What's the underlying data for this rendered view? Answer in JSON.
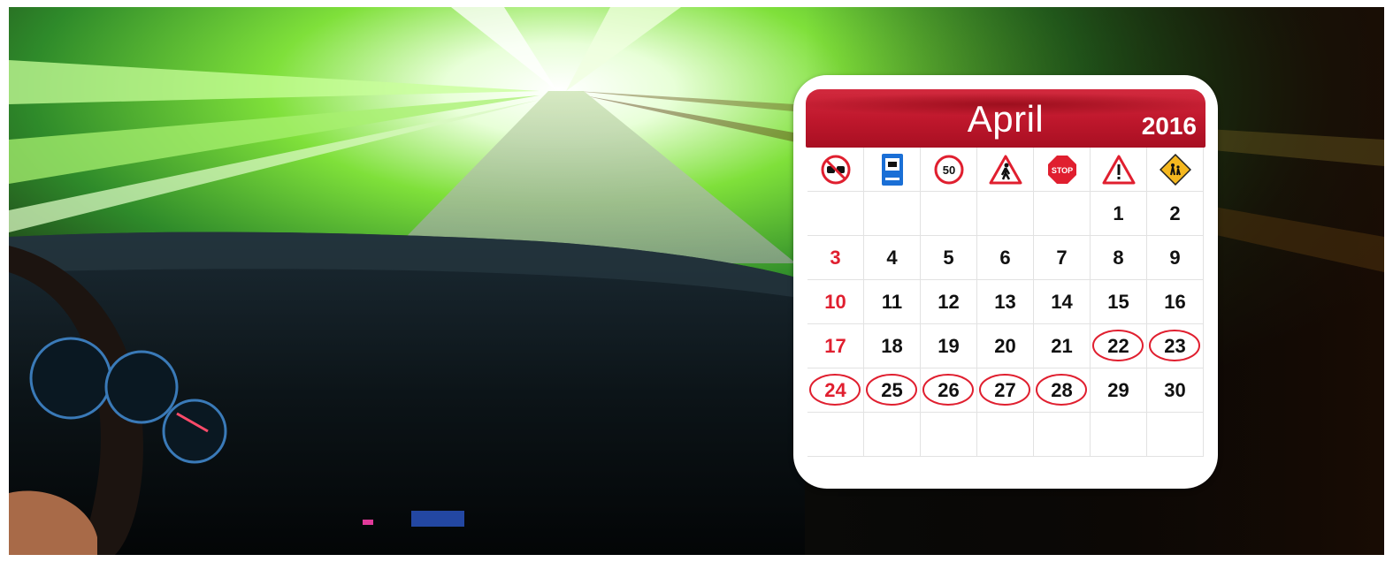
{
  "calendar": {
    "month": "April",
    "year": "2016",
    "sign_icons": [
      {
        "name": "no-overtaking-sign-icon"
      },
      {
        "name": "bus-stop-sign-icon"
      },
      {
        "name": "speed-limit-sign-icon",
        "text": "50"
      },
      {
        "name": "pedestrian-crossing-sign-icon"
      },
      {
        "name": "stop-sign-icon",
        "text": "STOP"
      },
      {
        "name": "warning-sign-icon"
      },
      {
        "name": "children-crossing-sign-icon"
      }
    ],
    "weeks": [
      [
        "",
        "",
        "",
        "",
        "",
        "1",
        "2"
      ],
      [
        "3",
        "4",
        "5",
        "6",
        "7",
        "8",
        "9"
      ],
      [
        "10",
        "11",
        "12",
        "13",
        "14",
        "15",
        "16"
      ],
      [
        "17",
        "18",
        "19",
        "20",
        "21",
        "22",
        "23"
      ],
      [
        "24",
        "25",
        "26",
        "27",
        "28",
        "29",
        "30"
      ],
      [
        "",
        "",
        "",
        "",
        "",
        "",
        ""
      ]
    ],
    "circled_days": [
      "22",
      "23",
      "24",
      "25",
      "26",
      "27",
      "28"
    ],
    "colors": {
      "banner": "#c0182d",
      "sunday": "#e01f2f",
      "circle": "#e01f2f"
    }
  }
}
